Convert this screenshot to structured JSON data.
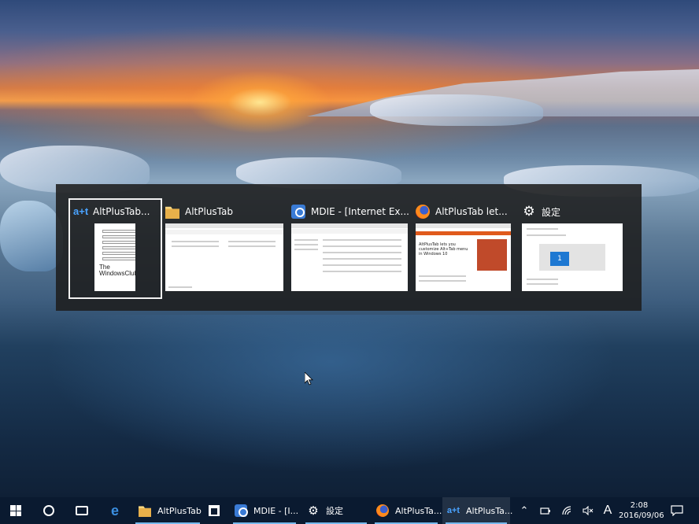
{
  "switcher": {
    "items": [
      {
        "title": "AltPlusTab...",
        "icon": "altplustab-icon",
        "selected": true
      },
      {
        "title": "AltPlusTab",
        "icon": "folder-icon",
        "selected": false
      },
      {
        "title": "MDIE - [Internet Ex...",
        "icon": "mdie-icon",
        "selected": false
      },
      {
        "title": "AltPlusTab let...",
        "icon": "firefox-icon",
        "selected": false
      },
      {
        "title": "設定",
        "icon": "gear-icon",
        "selected": false
      }
    ],
    "thumb1": {
      "brand_line1": "The",
      "brand_line2": "WindowsClub"
    },
    "thumb4": {
      "headline": "AltPlusTab lets you customize Alt+Tab menu in Windows 10"
    },
    "thumb5": {
      "tile_label": "1"
    },
    "apt_glyph": "a+t"
  },
  "taskbar": {
    "buttons": [
      {
        "label": "AltPlusTab",
        "icon": "folder-icon"
      },
      {
        "label": "MDIE - [I...",
        "icon": "mdie-icon"
      },
      {
        "label": "設定",
        "icon": "gear-icon"
      },
      {
        "label": "AltPlusTa...",
        "icon": "firefox-icon"
      },
      {
        "label": "AltPlusTa...",
        "icon": "altplustab-icon"
      }
    ],
    "ime": "A",
    "time": "2:08",
    "date": "2016/09/06"
  },
  "colors": {
    "accent": "#76b9ed",
    "taskbar": "#0a1a30"
  }
}
